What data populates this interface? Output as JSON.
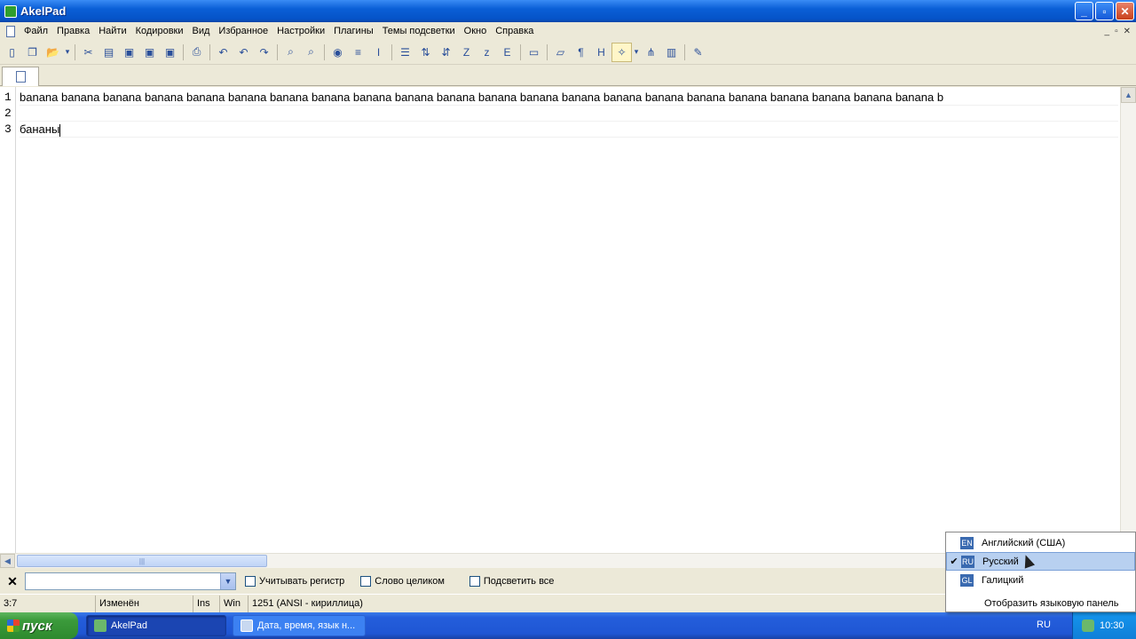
{
  "window": {
    "title": "AkelPad"
  },
  "menu": [
    "Файл",
    "Правка",
    "Найти",
    "Кодировки",
    "Вид",
    "Избранное",
    "Настройки",
    "Плагины",
    "Темы подсветки",
    "Окно",
    "Справка"
  ],
  "mdi_controls": [
    "_",
    "▫",
    "✕"
  ],
  "toolbar_icons": [
    "new-icon",
    "copy-icon",
    "open-icon",
    "dropdown-icon",
    "sep",
    "cut-icon",
    "paste-icon",
    "save-icon",
    "save-all-icon",
    "save-as-icon",
    "sep",
    "print-icon",
    "sep",
    "undo-all-icon",
    "undo-icon",
    "redo-icon",
    "sep",
    "find-icon",
    "replace-icon",
    "sep",
    "goto-icon",
    "insert-icon",
    "cursor-icon",
    "sep",
    "list-icon",
    "sort-asc-icon",
    "sort-desc-icon",
    "case-upper-icon",
    "case-lower-icon",
    "encoding-icon",
    "sep",
    "image-icon",
    "sep",
    "folder-icon",
    "pilcrow-icon",
    "hex-icon",
    "bulb-icon",
    "dropdown-icon",
    "tree-icon",
    "clipboard-icon",
    "sep",
    "wrench-icon"
  ],
  "editor": {
    "line_numbers": [
      "1",
      "2",
      "3"
    ],
    "lines": [
      "banana  banana  banana  banana  banana  banana  banana  banana  banana  banana  banana  banana  banana  banana  banana  banana  banana  banana  banana  banana  banana  banana  b",
      "",
      "бананы"
    ]
  },
  "find_bar": {
    "close": "✕",
    "checkboxes": [
      "Учитывать регистр",
      "Слово целиком",
      "Подсветить все"
    ]
  },
  "status_bar": {
    "position": "3:7",
    "modified": "Изменён",
    "insert_mode": "Ins",
    "newline": "Win",
    "encoding": "1251  (ANSI - кириллица)"
  },
  "taskbar": {
    "start": "пуск",
    "tasks": [
      "AkelPad",
      "Дата, время, язык н..."
    ],
    "language": "RU",
    "clock": "10:30"
  },
  "language_menu": {
    "items": [
      {
        "code": "EN",
        "label": "Английский (США)",
        "checked": false,
        "color": "#3a6ab0"
      },
      {
        "code": "RU",
        "label": "Русский",
        "checked": true,
        "color": "#3a6ab0"
      },
      {
        "code": "GL",
        "label": "Галицкий",
        "checked": false,
        "color": "#3a6ab0"
      }
    ],
    "action": "Отобразить языковую панель"
  }
}
